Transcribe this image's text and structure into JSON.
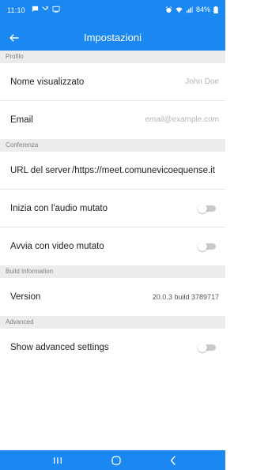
{
  "status_bar": {
    "time": "11:10",
    "battery": "84%",
    "left_icons": [
      "message-icon",
      "missed-call-icon",
      "cast-icon"
    ],
    "right_icons": [
      "alarm-icon",
      "wifi-icon",
      "signal-icon",
      "battery-icon"
    ]
  },
  "app_bar": {
    "title": "Impostazioni",
    "back_icon": "arrow-left-icon",
    "color": "#1a88f0"
  },
  "sections": {
    "profile": {
      "header": "Profilo",
      "display_name_label": "Nome visualizzato",
      "display_name_value": "John Doe",
      "email_label": "Email",
      "email_value": "email@example.com"
    },
    "conference": {
      "header": "Conferenza",
      "server_url_label": "URL del server",
      "server_url_value": "https://meet.comunevicoequense.it/",
      "audio_muted_label": "Inizia con l'audio mutato",
      "audio_muted": false,
      "video_muted_label": "Avvia con video mutato",
      "video_muted": false
    },
    "build": {
      "header": "Build Information",
      "version_label": "Version",
      "version_value": "20.0.3 build 3789717"
    },
    "advanced": {
      "header": "Advanced",
      "show_advanced_label": "Show advanced settings",
      "show_advanced": false
    }
  },
  "nav_bar": {
    "buttons": [
      "recent-apps-icon",
      "home-icon",
      "back-icon"
    ]
  }
}
